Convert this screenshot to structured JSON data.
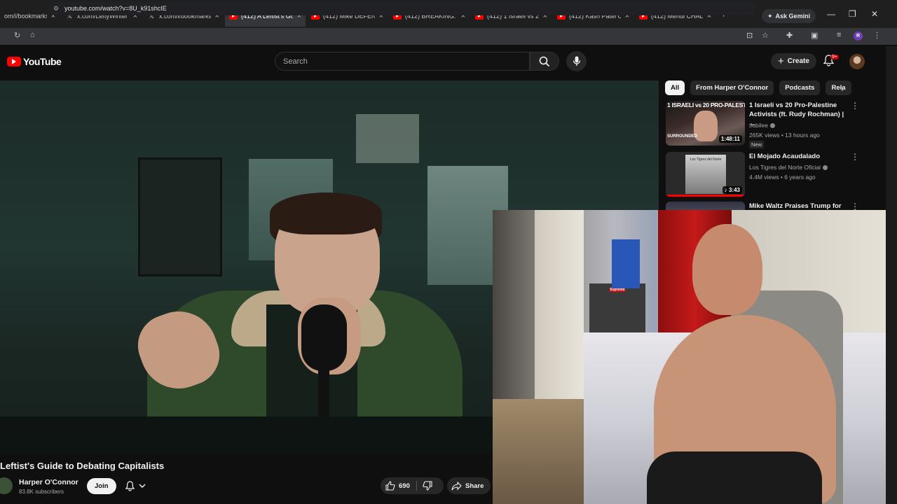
{
  "browser": {
    "tabs": [
      {
        "label": "om/i/bookmarks",
        "icon": "x-logo"
      },
      {
        "label": "x.com/LeftyWinter",
        "icon": "x-logo"
      },
      {
        "label": "x.com/i/bookmarks",
        "icon": "x-logo"
      },
      {
        "label": "(412) A Leftist's Gu",
        "icon": "youtube-logo",
        "active": true
      },
      {
        "label": "(412) Mike DEFEN",
        "icon": "youtube-logo"
      },
      {
        "label": "(412) BREAKING: S",
        "icon": "youtube-logo"
      },
      {
        "label": "(412) 1 Israeli vs 20",
        "icon": "youtube-logo"
      },
      {
        "label": "(412) Kash Patel Ca",
        "icon": "youtube-logo"
      },
      {
        "label": "(412) Mehdi CHALL",
        "icon": "youtube-logo"
      }
    ],
    "close_glyph": "×",
    "new_tab": "+",
    "ask_gemini": "Ask Gemini",
    "url": "youtube.com/watch?v=8U_k91shcIE",
    "profile_letter": "R"
  },
  "youtube": {
    "logo_text": "YouTube",
    "search_placeholder": "Search",
    "create_label": "Create",
    "notif_count": "9+",
    "chips": [
      "All",
      "From Harper O'Connor",
      "Podcasts",
      "Rela"
    ],
    "recommendations": [
      {
        "thumb_text": "1 ISRAELI vs 20 PRO-PALESTINE",
        "thumb_badge": "SURROUNDED",
        "title": "1 Israeli vs 20 Pro-Palestine Activists (ft. Rudy Rochman) | ...",
        "channel": "Jubilee",
        "meta": "265K views • 13 hours ago",
        "badge": "New",
        "duration": "1:48:11"
      },
      {
        "thumb_text": "Los Tigres del Norte",
        "title": "El Mojado Acaudalado",
        "channel": "Los Tigres del Norte Oficial",
        "meta": "4.4M views • 6 years ago",
        "duration": "3:43"
      },
      {
        "title": "Mike Waltz Praises Trump for"
      }
    ]
  },
  "video": {
    "title": "Leftist's Guide to Debating Capitalists",
    "channel_name": "Harper O'Connor",
    "subscribers": "83.8K subscribers",
    "join_label": "Join",
    "likes": "690",
    "share_label": "Share"
  },
  "webcam": {
    "box_label": "Supreme"
  }
}
